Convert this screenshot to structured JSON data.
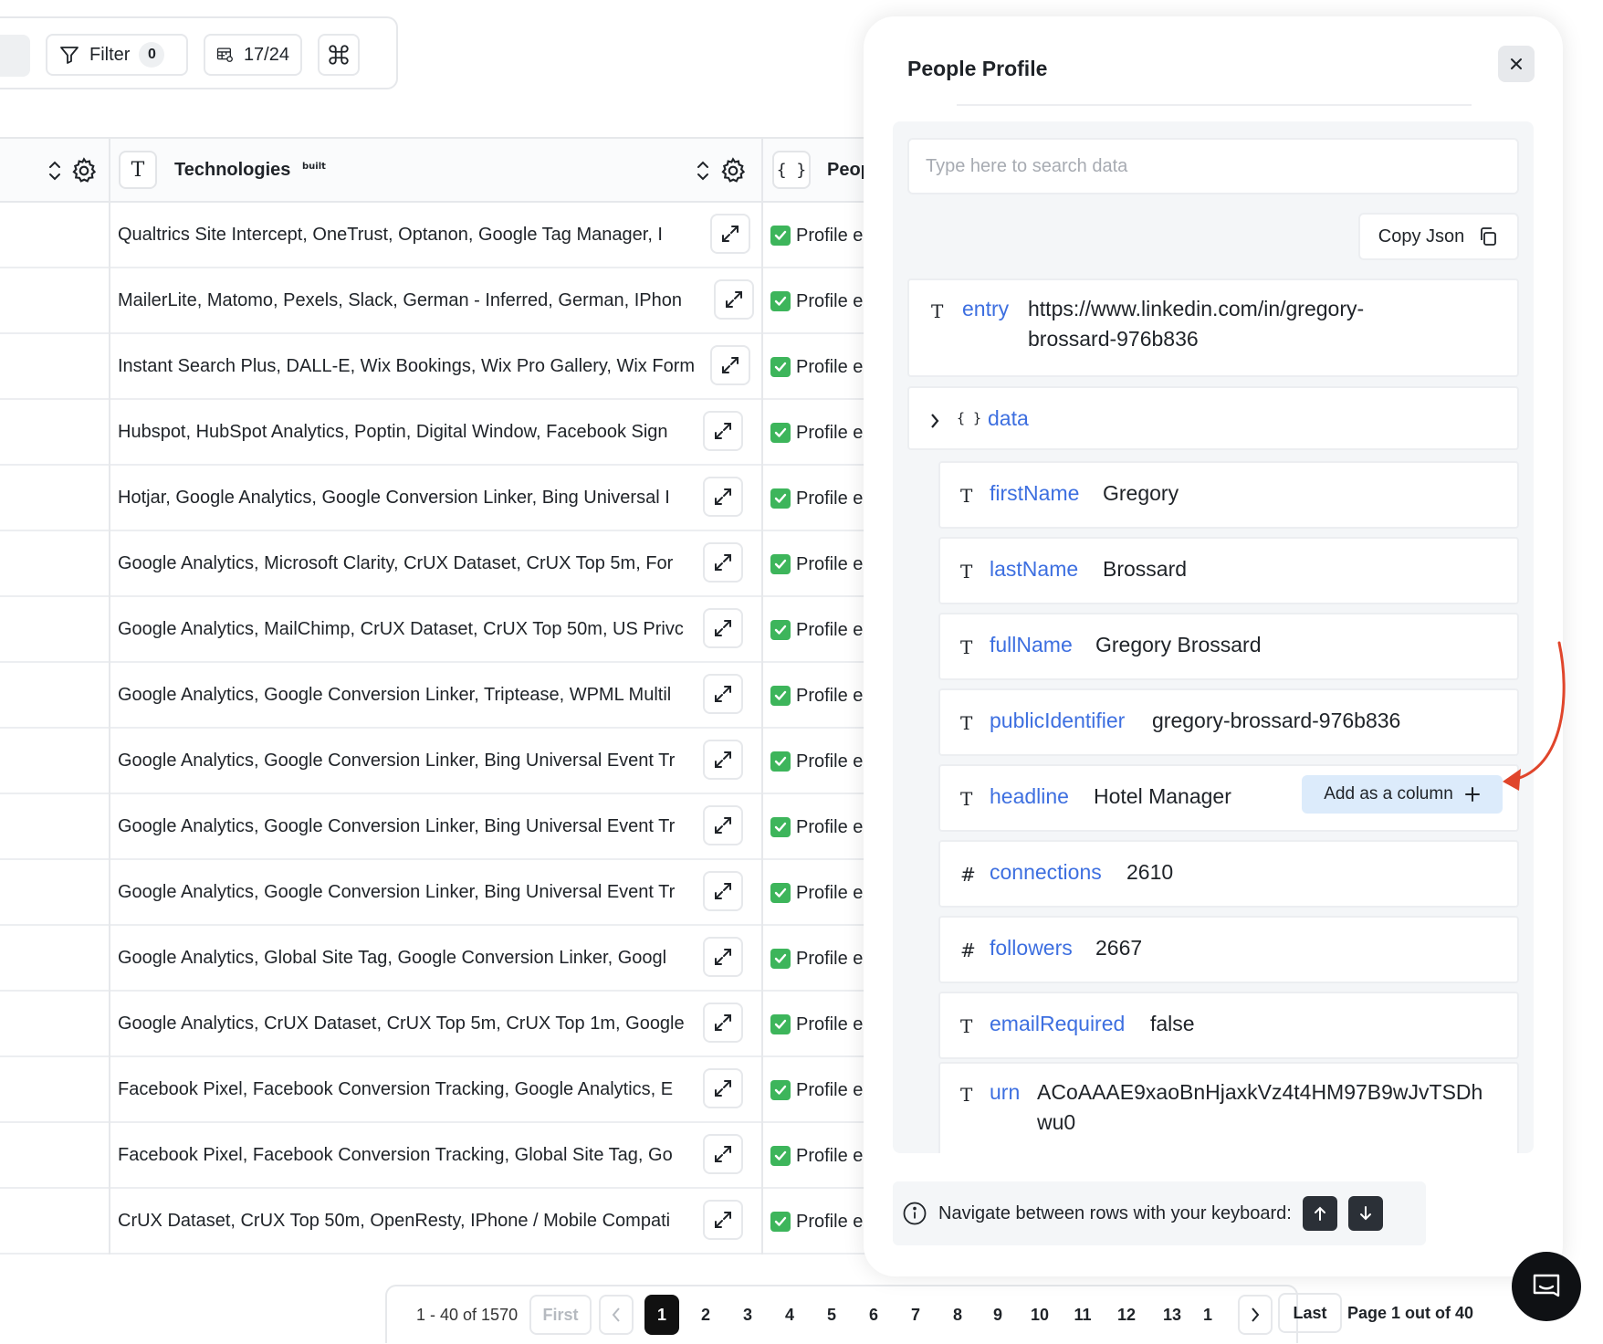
{
  "toolbar": {
    "filter_label": "Filter",
    "filter_count": "0",
    "columns_label": "17/24"
  },
  "table": {
    "headers": {
      "technologies": "Technologies",
      "people": "Peop"
    },
    "icons": {
      "text_type": "T",
      "json_type": "{ }",
      "builtwith_badge": "built with"
    },
    "profile_cell": "Profile e",
    "rows": [
      "Qualtrics Site Intercept, OneTrust, Optanon, Google Tag Manager, I",
      "MailerLite, Matomo, Pexels, Slack, German - Inferred, German, IPhon",
      "Instant Search Plus, DALL-E, Wix Bookings, Wix Pro Gallery, Wix Form",
      "Hubspot, HubSpot Analytics, Poptin, Digital Window, Facebook Sign",
      "Hotjar, Google Analytics, Google Conversion Linker, Bing Universal I",
      "Google Analytics, Microsoft Clarity, CrUX Dataset, CrUX Top 5m, For",
      "Google Analytics, MailChimp, CrUX Dataset, CrUX Top 50m, US Privc",
      "Google Analytics, Google Conversion Linker, Triptease, WPML Multil",
      "Google Analytics, Google Conversion Linker, Bing Universal Event Tr",
      "Google Analytics, Google Conversion Linker, Bing Universal Event Tr",
      "Google Analytics, Google Conversion Linker, Bing Universal Event Tr",
      "Google Analytics, Global Site Tag, Google Conversion Linker, Googl",
      "Google Analytics, CrUX Dataset, CrUX Top 5m, CrUX Top 1m, Google",
      "Facebook Pixel, Facebook Conversion Tracking, Google Analytics, E",
      "Facebook Pixel, Facebook Conversion Tracking, Global Site Tag, Go",
      "CrUX Dataset, CrUX Top 50m, OpenResty, IPhone / Mobile Compati"
    ]
  },
  "pagination": {
    "range": "1 - 40 of 1570",
    "first": "First",
    "pages": [
      "1",
      "2",
      "3",
      "4",
      "5",
      "6",
      "7",
      "8",
      "9",
      "10",
      "11",
      "12",
      "13",
      "1"
    ],
    "active_page": "1",
    "last": "Last",
    "page_status": "Page 1 out of 40"
  },
  "panel": {
    "title": "People Profile",
    "search_placeholder": "Type here to search data",
    "copy_label": "Copy Json",
    "type_glyph_text": "T",
    "type_glyph_number": "#",
    "type_glyph_object": "{ }",
    "entry": {
      "key": "entry",
      "value_line1": "https://www.linkedin.com/in/gregory-",
      "value_line2": "brossard-976b836"
    },
    "data_key": "data",
    "fields": [
      {
        "type": "T",
        "key": "firstName",
        "value": "Gregory"
      },
      {
        "type": "T",
        "key": "lastName",
        "value": "Brossard"
      },
      {
        "type": "T",
        "key": "fullName",
        "value": "Gregory Brossard"
      },
      {
        "type": "T",
        "key": "publicIdentifier",
        "value": "gregory-brossard-976b836"
      },
      {
        "type": "T",
        "key": "headline",
        "value": "Hotel Manager"
      },
      {
        "type": "#",
        "key": "connections",
        "value": "2610"
      },
      {
        "type": "#",
        "key": "followers",
        "value": "2667"
      },
      {
        "type": "T",
        "key": "emailRequired",
        "value": "false"
      }
    ],
    "urn": {
      "type": "T",
      "key": "urn",
      "value_line1": "ACoAAAE9xaoBnHjaxkVz4t4HM97B9wJvTSDh",
      "value_line2": "wu0"
    },
    "add_column_label": "Add as a column",
    "hint": "Navigate between rows with your keyboard:"
  },
  "colors": {
    "accent_key": "#3d6fe0",
    "add_column_bg": "#dcebfb",
    "annotation_arrow": "#e0452b",
    "check_green": "#3db55b"
  }
}
